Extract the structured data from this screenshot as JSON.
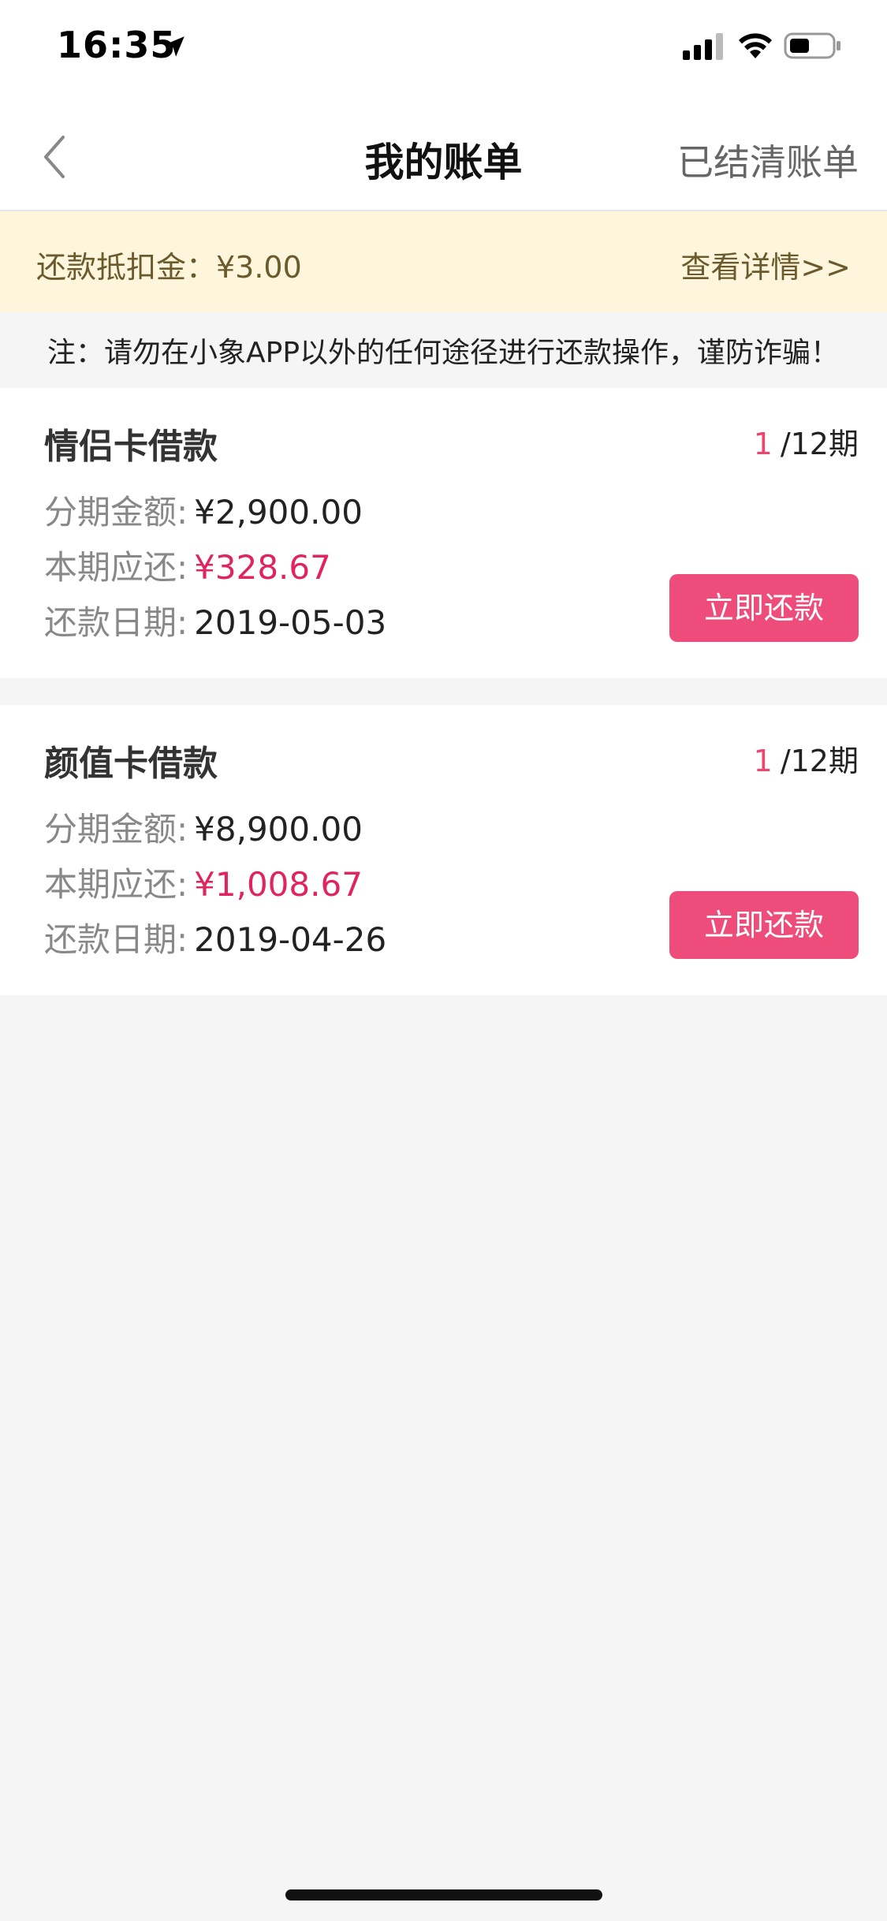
{
  "status_bar": {
    "time": "16:35"
  },
  "nav": {
    "title": "我的账单",
    "settled_label": "已结清账单"
  },
  "banner": {
    "deduction_label": "还款抵扣金：¥3.00",
    "detail_link": "查看详情>>"
  },
  "notice": {
    "text": "注：请勿在小象APP以外的任何途径进行还款操作，谨防诈骗！"
  },
  "labels": {
    "installment_amount": "分期金额:",
    "current_due": "本期应还:",
    "repay_date": "还款日期:",
    "repay_button": "立即还款"
  },
  "loans": [
    {
      "title": "情侣卡借款",
      "period_current": "1",
      "period_total": "/12期",
      "installment_amount": "¥2,900.00",
      "current_due": "¥328.67",
      "repay_date": "2019-05-03"
    },
    {
      "title": "颜值卡借款",
      "period_current": "1",
      "period_total": "/12期",
      "installment_amount": "¥8,900.00",
      "current_due": "¥1,008.67",
      "repay_date": "2019-04-26"
    }
  ],
  "colors": {
    "accent": "#ee4d7b",
    "due_amount": "#e0245e",
    "banner_bg": "#fdf6dc",
    "banner_text": "#6b5a2c"
  }
}
